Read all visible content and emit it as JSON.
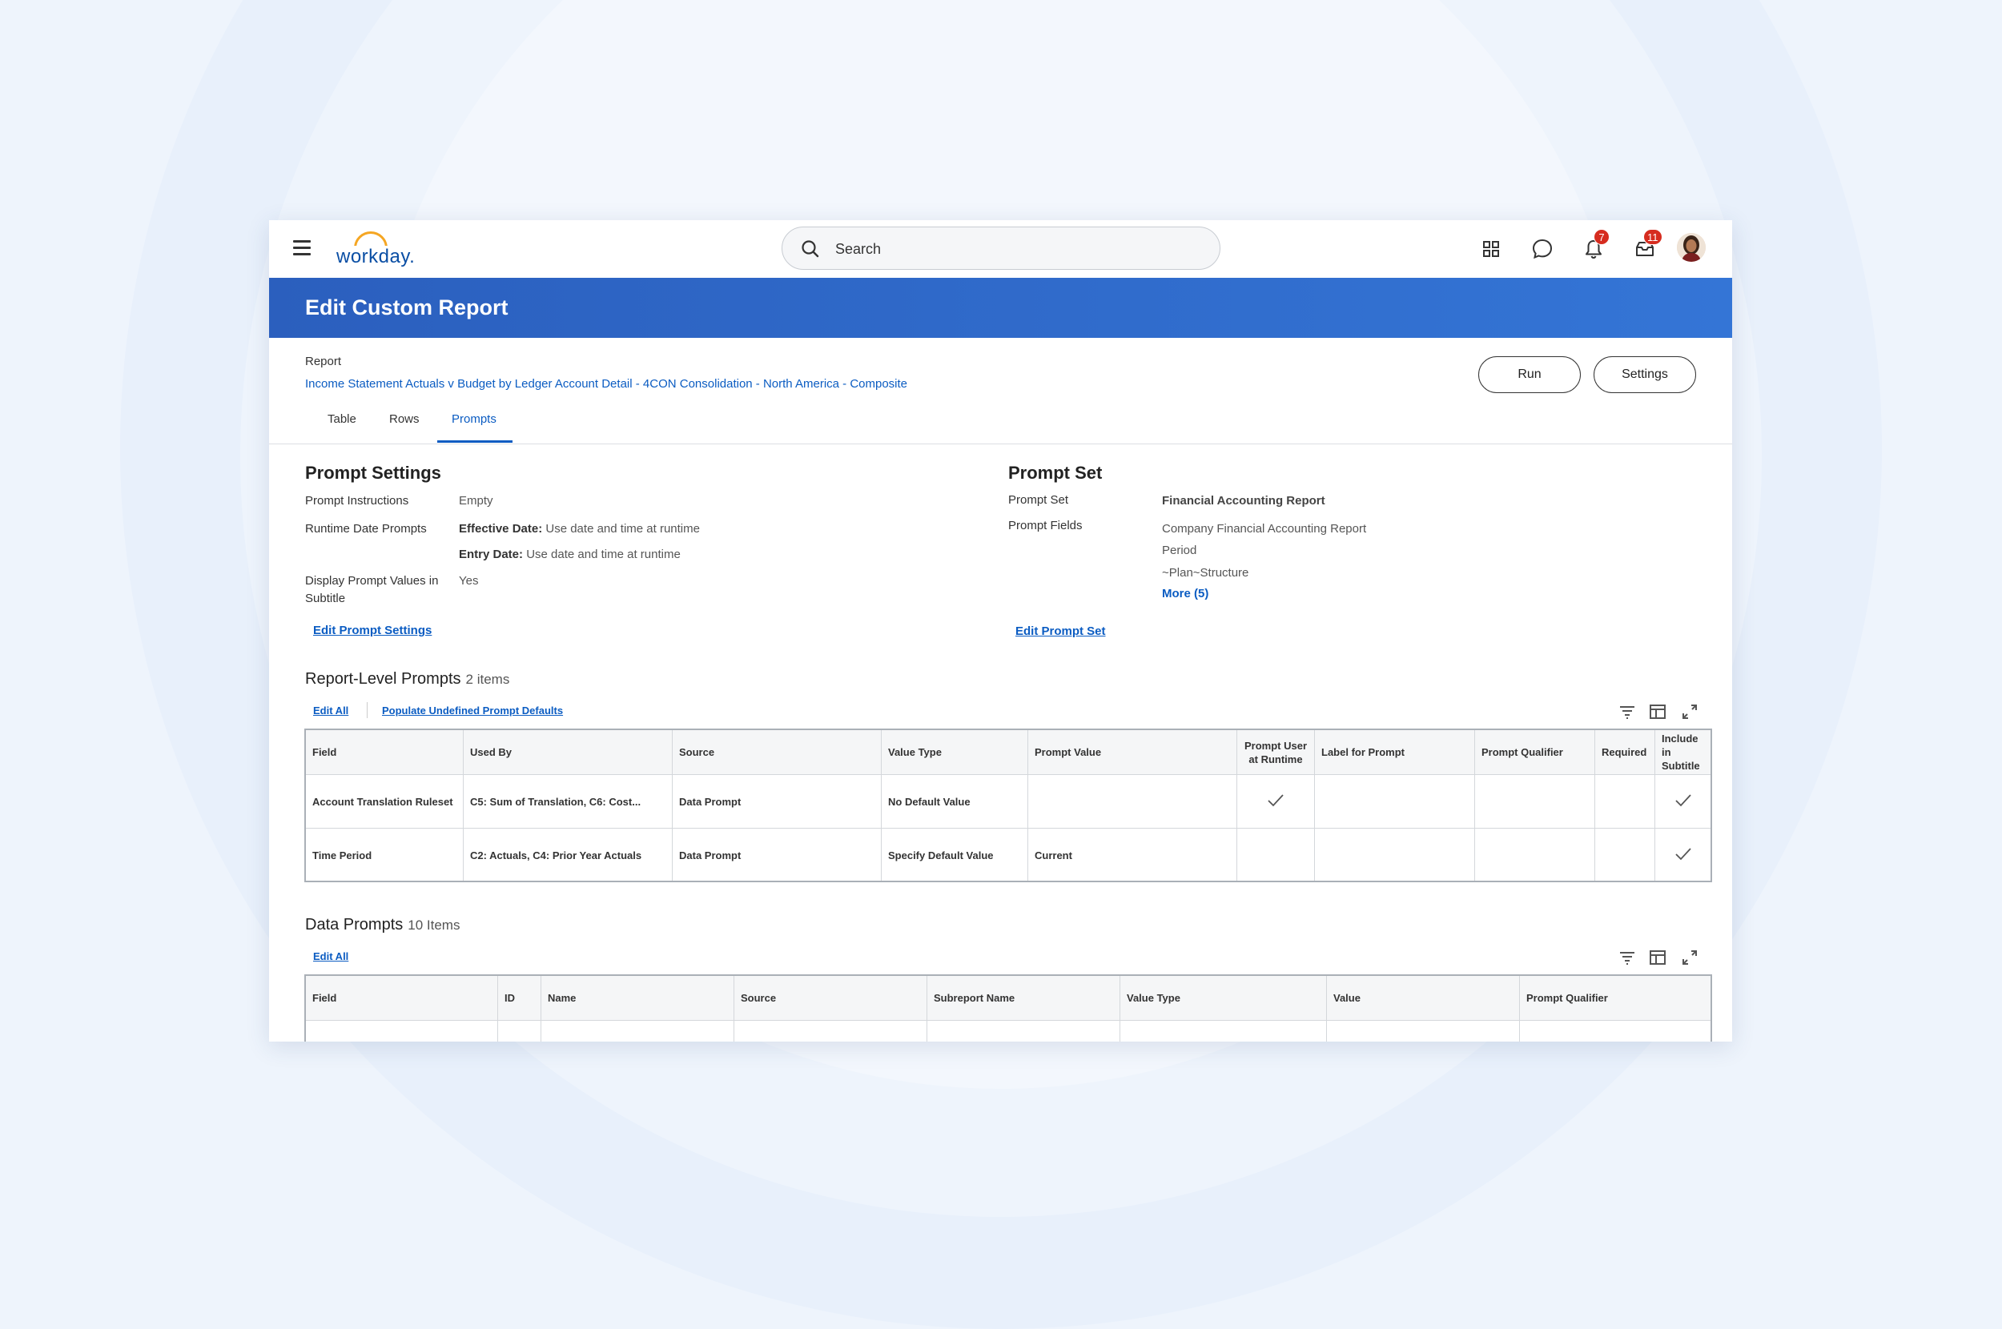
{
  "app": {
    "logo_text": "workday.",
    "search_placeholder": "Search",
    "notification_count": "7",
    "inbox_count": "11"
  },
  "header": {
    "title": "Edit Custom Report"
  },
  "report": {
    "label": "Report",
    "name": "Income Statement Actuals v Budget by Ledger Account Detail - 4CON Consolidation - North America - Composite",
    "run_label": "Run",
    "settings_label": "Settings"
  },
  "tabs": [
    "Table",
    "Rows",
    "Prompts"
  ],
  "prompt_settings": {
    "title": "Prompt Settings",
    "instructions_label": "Prompt Instructions",
    "instructions_value": "Empty",
    "runtime_label": "Runtime Date Prompts",
    "effective_label": "Effective Date:",
    "effective_value": "Use date and time at runtime",
    "entry_label": "Entry Date:",
    "entry_value": "Use date and time at runtime",
    "display_label": "Display Prompt Values in Subtitle",
    "display_value": "Yes",
    "edit_link": "Edit Prompt Settings"
  },
  "prompt_set": {
    "title": "Prompt Set",
    "set_label": "Prompt Set",
    "set_value": "Financial Accounting Report",
    "fields_label": "Prompt Fields",
    "fields": [
      "Company Financial Accounting Report",
      "Period",
      "~Plan~Structure"
    ],
    "more_link": "More (5)",
    "edit_link": "Edit Prompt Set"
  },
  "report_level_prompts": {
    "title": "Report-Level Prompts",
    "count": "2 items",
    "edit_all": "Edit All",
    "populate": "Populate Undefined Prompt Defaults",
    "columns": [
      "Field",
      "Used By",
      "Source",
      "Value Type",
      "Prompt Value",
      "Prompt User at Runtime",
      "Label for Prompt",
      "Prompt Qualifier",
      "Required",
      "Include in Subtitle"
    ],
    "rows": [
      {
        "field": "Account Translation Ruleset",
        "used_by": "C5:  Sum of Translation, C6: Cost...",
        "source": "Data Prompt",
        "value_type": "No Default Value",
        "prompt_value": "",
        "prompt_user": true,
        "label": "",
        "qualifier": "",
        "required": false,
        "include": true
      },
      {
        "field": "Time Period",
        "used_by": "C2:  Actuals, C4: Prior Year Actuals",
        "source": "Data Prompt",
        "value_type": "Specify Default Value",
        "prompt_value": "Current",
        "prompt_user": false,
        "label": "",
        "qualifier": "",
        "required": false,
        "include": true
      }
    ]
  },
  "data_prompts": {
    "title": "Data Prompts",
    "count": "10 Items",
    "edit_all": "Edit All",
    "columns": [
      "Field",
      "ID",
      "Name",
      "Source",
      "Subreport Name",
      "Value Type",
      "Value",
      "Prompt Qualifier"
    ]
  },
  "colors": {
    "header_blue": "#2b5fbe",
    "link_blue": "#0b5cc2",
    "badge_red": "#d62c1f",
    "logo_orange": "#f5a623"
  }
}
